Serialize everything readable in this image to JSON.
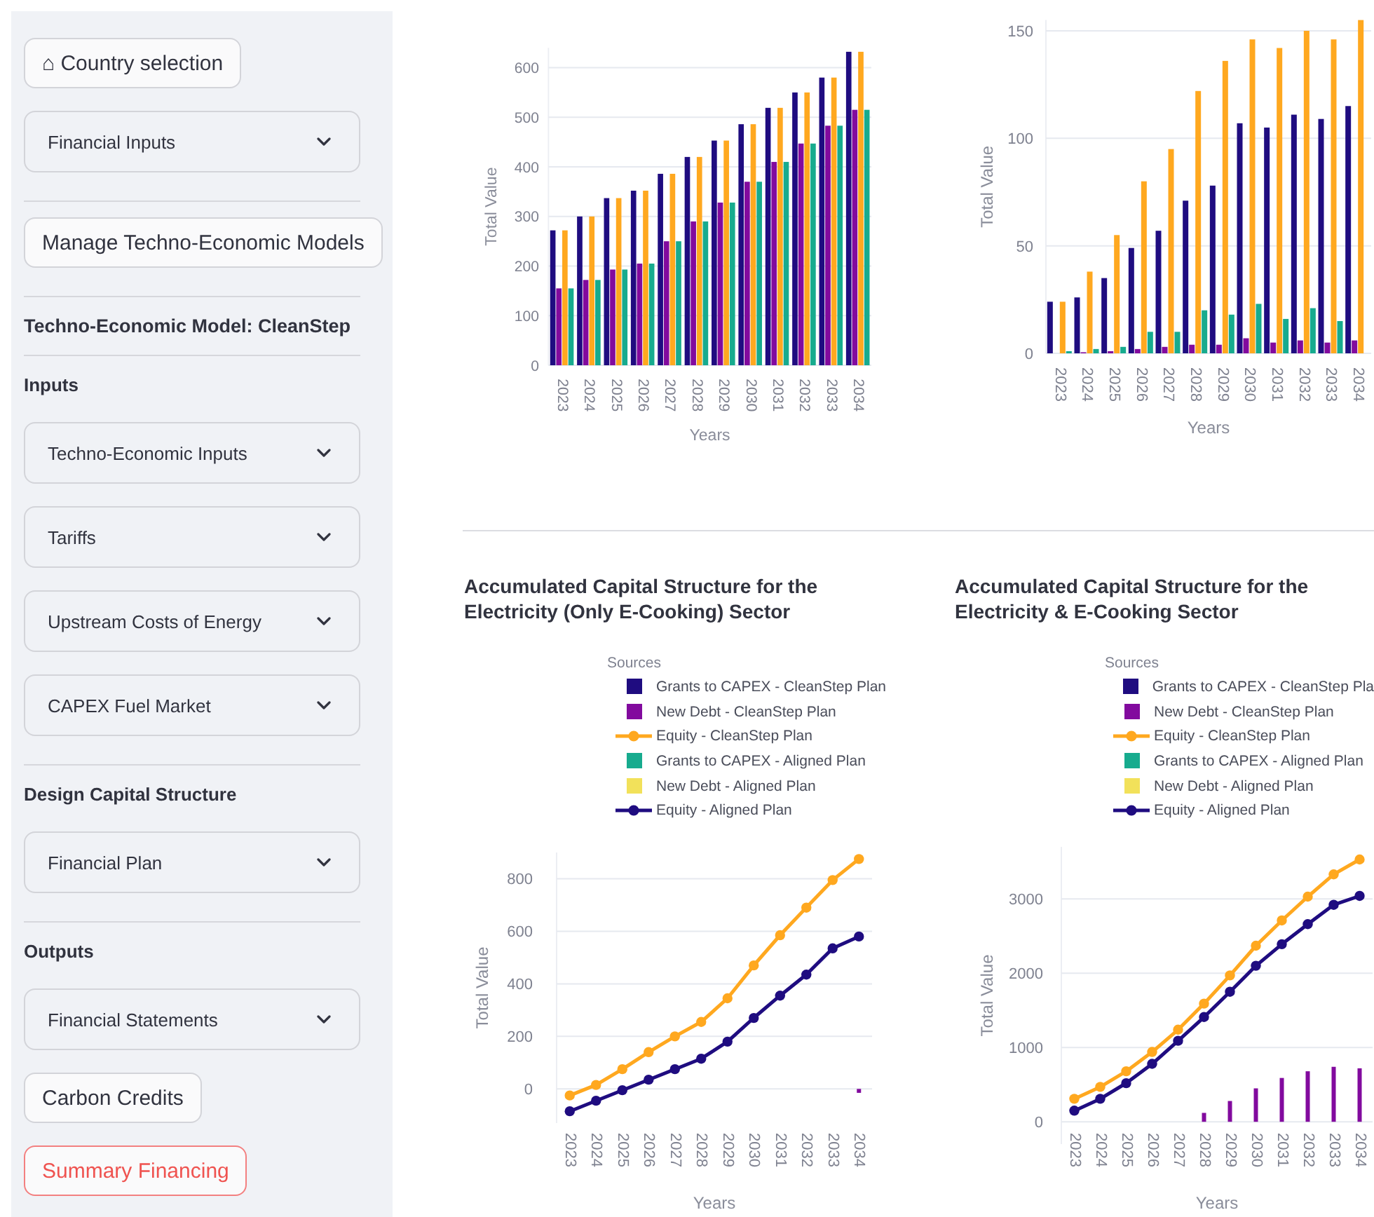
{
  "sidebar": {
    "items": [
      {
        "kind": "button",
        "label": "⌂ Country selection",
        "selected": false
      },
      {
        "kind": "expander",
        "label": "Financial Inputs",
        "expanded": false
      },
      {
        "kind": "divider"
      },
      {
        "kind": "button",
        "label": "Manage Techno-Economic Models",
        "selected": false
      },
      {
        "kind": "divider"
      },
      {
        "kind": "title",
        "label": "Techno-Economic Model: CleanStep"
      },
      {
        "kind": "divider"
      },
      {
        "kind": "heading",
        "label": "Inputs"
      },
      {
        "kind": "expander",
        "label": "Techno-Economic Inputs",
        "expanded": false
      },
      {
        "kind": "expander",
        "label": "Tariffs",
        "expanded": false
      },
      {
        "kind": "expander",
        "label": "Upstream Costs of Energy",
        "expanded": false
      },
      {
        "kind": "expander",
        "label": "CAPEX Fuel Market",
        "expanded": false
      },
      {
        "kind": "divider"
      },
      {
        "kind": "heading",
        "label": "Design Capital Structure"
      },
      {
        "kind": "expander",
        "label": "Financial Plan",
        "expanded": false
      },
      {
        "kind": "divider"
      },
      {
        "kind": "heading",
        "label": "Outputs"
      },
      {
        "kind": "expander",
        "label": "Financial Statements",
        "expanded": false
      },
      {
        "kind": "button",
        "label": "Carbon Credits",
        "selected": false
      },
      {
        "kind": "button",
        "label": "Summary Financing",
        "selected": true
      }
    ]
  },
  "charts_top": [
    {
      "chart_data": {
        "type": "bar",
        "xlabel": "Years",
        "ylabel": "Total Value",
        "grid": true,
        "categories": [
          "2023",
          "2024",
          "2025",
          "2026",
          "2027",
          "2028",
          "2029",
          "2030",
          "2031",
          "2032",
          "2033",
          "2034"
        ],
        "ylim": [
          0,
          640
        ],
        "yticks": [
          0,
          100,
          200,
          300,
          400,
          500,
          600
        ],
        "series": [
          {
            "color": "#1f0c80",
            "values": [
              272,
              300,
              337,
              352,
              386,
              420,
              453,
              486,
              519,
              550,
              580,
              632
            ]
          },
          {
            "color": "#820a9e",
            "values": [
              155,
              172,
              193,
              205,
              250,
              290,
              328,
              370,
              410,
              447,
              483,
              515
            ]
          },
          {
            "color": "#ffa81f",
            "values": [
              272,
              300,
              337,
              352,
              386,
              420,
              453,
              486,
              519,
              550,
              580,
              632
            ]
          },
          {
            "color": "#17ab8e",
            "values": [
              155,
              172,
              193,
              205,
              250,
              290,
              328,
              370,
              410,
              447,
              483,
              515
            ]
          }
        ]
      }
    },
    {
      "chart_data": {
        "type": "bar",
        "xlabel": "Years",
        "ylabel": "Total Value",
        "grid": true,
        "categories": [
          "2023",
          "2024",
          "2025",
          "2026",
          "2027",
          "2028",
          "2029",
          "2030",
          "2031",
          "2032",
          "2033",
          "2034"
        ],
        "ylim": [
          0,
          155
        ],
        "yticks": [
          0,
          50,
          100,
          150
        ],
        "series": [
          {
            "color": "#1f0c80",
            "values": [
              24,
              26,
              35,
              49,
              57,
              71,
              78,
              107,
              105,
              111,
              109,
              115
            ]
          },
          {
            "color": "#820a9e",
            "values": [
              0,
              0.5,
              1,
              2,
              3,
              4,
              4,
              7,
              5,
              6,
              5,
              6
            ]
          },
          {
            "color": "#ffa81f",
            "values": [
              24,
              38,
              55,
              80,
              95,
              122,
              136,
              146,
              142,
              150,
              146,
              155
            ]
          },
          {
            "color": "#17ab8e",
            "values": [
              1,
              2,
              3,
              10,
              10,
              20,
              18,
              23,
              16,
              21,
              15,
              null
            ]
          }
        ]
      }
    }
  ],
  "charts_bottom": [
    {
      "legend_title": "Sources",
      "chart_data": {
        "type": "line",
        "title": "Accumulated Capital Structure for the Electricity (Only E-Cooking) Sector",
        "xlabel": "Years",
        "ylabel": "Total Value",
        "grid": true,
        "categories": [
          "2023",
          "2024",
          "2025",
          "2026",
          "2027",
          "2028",
          "2029",
          "2030",
          "2031",
          "2032",
          "2033",
          "2034"
        ],
        "ylim": [
          -130,
          900
        ],
        "yticks": [
          0,
          200,
          400,
          600,
          800
        ],
        "series": [
          {
            "name": "Grants to CAPEX - CleanStep Plan",
            "type": "bar",
            "color": "#1f0c80",
            "values": [
              null,
              null,
              null,
              null,
              null,
              null,
              null,
              null,
              null,
              null,
              null,
              null
            ]
          },
          {
            "name": "New Debt - CleanStep Plan",
            "type": "bar",
            "color": "#820a9e",
            "values": [
              null,
              null,
              null,
              null,
              null,
              null,
              null,
              null,
              null,
              null,
              null,
              -15
            ]
          },
          {
            "name": "Equity - CleanStep Plan",
            "type": "line",
            "marker": true,
            "color": "#ffa81f",
            "values": [
              -25,
              15,
              75,
              140,
              200,
              255,
              345,
              470,
              585,
              690,
              795,
              875
            ]
          },
          {
            "name": "Grants to CAPEX - Aligned Plan",
            "type": "bar",
            "color": "#17ab8e",
            "values": [
              null,
              null,
              null,
              null,
              null,
              null,
              null,
              null,
              null,
              null,
              null,
              null
            ]
          },
          {
            "name": "New Debt - Aligned Plan",
            "type": "bar",
            "color": "#f2e15a",
            "values": [
              null,
              null,
              null,
              null,
              null,
              null,
              null,
              null,
              null,
              null,
              null,
              null
            ]
          },
          {
            "name": "Equity - Aligned Plan",
            "type": "line",
            "marker": true,
            "color": "#1f0c80",
            "values": [
              -85,
              -45,
              -5,
              35,
              75,
              115,
              180,
              270,
              355,
              435,
              535,
              580
            ]
          }
        ]
      }
    },
    {
      "legend_title": "Sources",
      "chart_data": {
        "type": "line",
        "title": "Accumulated Capital Structure for the Electricity & E-Cooking Sector",
        "xlabel": "Years",
        "ylabel": "Total Value",
        "grid": true,
        "categories": [
          "2023",
          "2024",
          "2025",
          "2026",
          "2027",
          "2028",
          "2029",
          "2030",
          "2031",
          "2032",
          "2033",
          "2034"
        ],
        "ylim": [
          -300,
          3700
        ],
        "yticks": [
          0,
          1000,
          2000,
          3000
        ],
        "series": [
          {
            "name": "Grants to CAPEX - CleanStep Pla",
            "type": "bar",
            "color": "#1f0c80",
            "values": [
              null,
              null,
              null,
              null,
              null,
              null,
              null,
              null,
              null,
              null,
              null,
              null
            ]
          },
          {
            "name": "New Debt - CleanStep Plan",
            "type": "bar",
            "color": "#820a9e",
            "values": [
              null,
              null,
              null,
              null,
              null,
              120,
              280,
              450,
              590,
              680,
              740,
              720
            ]
          },
          {
            "name": "Equity - CleanStep Plan",
            "type": "line",
            "marker": true,
            "color": "#ffa81f",
            "values": [
              310,
              470,
              680,
              940,
              1240,
              1590,
              1970,
              2370,
              2710,
              3030,
              3330,
              3530
            ]
          },
          {
            "name": "Grants to CAPEX - Aligned Plan",
            "type": "bar",
            "color": "#17ab8e",
            "values": [
              null,
              null,
              null,
              null,
              null,
              null,
              null,
              null,
              null,
              null,
              null,
              null
            ]
          },
          {
            "name": "New Debt - Aligned Plan",
            "type": "bar",
            "color": "#f2e15a",
            "values": [
              null,
              null,
              null,
              null,
              null,
              null,
              null,
              null,
              null,
              null,
              null,
              null
            ]
          },
          {
            "name": "Equity - Aligned Plan",
            "type": "line",
            "marker": true,
            "color": "#1f0c80",
            "values": [
              150,
              310,
              520,
              780,
              1090,
              1410,
              1750,
              2100,
              2390,
              2660,
              2920,
              3040
            ]
          }
        ]
      }
    }
  ]
}
